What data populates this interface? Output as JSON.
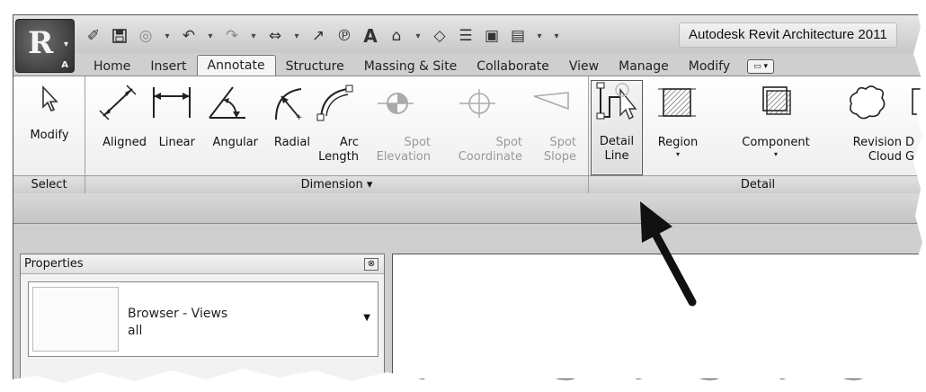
{
  "app": {
    "title": "Autodesk Revit Architecture 2011",
    "logo_letter": "R",
    "logo_sub": "A"
  },
  "qat": [
    {
      "icon": "open-folder-icon",
      "glyph": "✐"
    },
    {
      "icon": "save-icon",
      "glyph": "💾"
    },
    {
      "icon": "sync-icon",
      "glyph": "◎"
    },
    {
      "icon": "undo-icon",
      "glyph": "↶"
    },
    {
      "icon": "redo-icon",
      "glyph": "↷"
    },
    {
      "icon": "measure-icon",
      "glyph": "⇔"
    },
    {
      "icon": "aligned-dimension-icon",
      "glyph": "↗"
    },
    {
      "icon": "tag-icon",
      "glyph": "℗"
    },
    {
      "icon": "text-icon",
      "glyph": "A"
    },
    {
      "icon": "3d-view-icon",
      "glyph": "⌂"
    },
    {
      "icon": "section-icon",
      "glyph": "◇"
    },
    {
      "icon": "thin-lines-icon",
      "glyph": "☰"
    },
    {
      "icon": "close-hidden-icon",
      "glyph": "▣"
    },
    {
      "icon": "switch-windows-icon",
      "glyph": "▤"
    }
  ],
  "tabs": [
    "Home",
    "Insert",
    "Annotate",
    "Structure",
    "Massing & Site",
    "Collaborate",
    "View",
    "Manage",
    "Modify"
  ],
  "active_tab": "Annotate",
  "ribbon": {
    "select_panel": {
      "label": "Select",
      "modify": "Modify"
    },
    "dimension_panel": {
      "label": "Dimension ▾",
      "tools": {
        "aligned": "Aligned",
        "linear": "Linear",
        "angular": "Angular",
        "radial": "Radial",
        "arc_1": "Arc",
        "arc_2": "Length",
        "spot_elev_1": "Spot",
        "spot_elev_2": "Elevation",
        "spot_coord_1": "Spot",
        "spot_coord_2": "Coordinate",
        "spot_slope_1": "Spot",
        "spot_slope_2": "Slope"
      }
    },
    "detail_panel": {
      "label": "Detail",
      "tools": {
        "detail_line_1": "Detail",
        "detail_line_2": "Line",
        "region": "Region",
        "component": "Component",
        "revision_1": "Revision",
        "revision_2": "Cloud",
        "cut_1": "D",
        "cut_2": "G"
      }
    }
  },
  "properties": {
    "title": "Properties",
    "close": "⊗",
    "type_name_1": "Browser - Views",
    "type_name_2": "all"
  }
}
